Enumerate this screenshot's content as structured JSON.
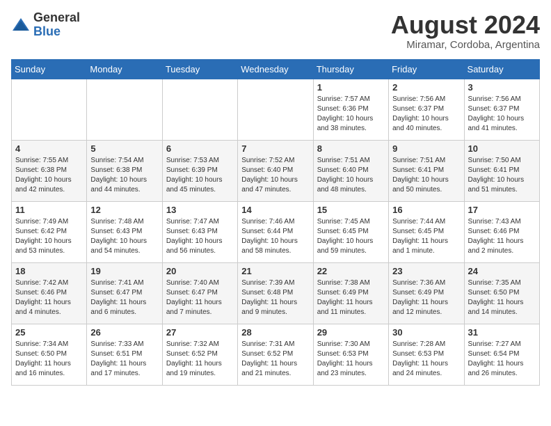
{
  "header": {
    "logo_line1": "General",
    "logo_line2": "Blue",
    "month_year": "August 2024",
    "location": "Miramar, Cordoba, Argentina"
  },
  "weekdays": [
    "Sunday",
    "Monday",
    "Tuesday",
    "Wednesday",
    "Thursday",
    "Friday",
    "Saturday"
  ],
  "rows": [
    [
      {
        "day": "",
        "info": ""
      },
      {
        "day": "",
        "info": ""
      },
      {
        "day": "",
        "info": ""
      },
      {
        "day": "",
        "info": ""
      },
      {
        "day": "1",
        "info": "Sunrise: 7:57 AM\nSunset: 6:36 PM\nDaylight: 10 hours\nand 38 minutes."
      },
      {
        "day": "2",
        "info": "Sunrise: 7:56 AM\nSunset: 6:37 PM\nDaylight: 10 hours\nand 40 minutes."
      },
      {
        "day": "3",
        "info": "Sunrise: 7:56 AM\nSunset: 6:37 PM\nDaylight: 10 hours\nand 41 minutes."
      }
    ],
    [
      {
        "day": "4",
        "info": "Sunrise: 7:55 AM\nSunset: 6:38 PM\nDaylight: 10 hours\nand 42 minutes."
      },
      {
        "day": "5",
        "info": "Sunrise: 7:54 AM\nSunset: 6:38 PM\nDaylight: 10 hours\nand 44 minutes."
      },
      {
        "day": "6",
        "info": "Sunrise: 7:53 AM\nSunset: 6:39 PM\nDaylight: 10 hours\nand 45 minutes."
      },
      {
        "day": "7",
        "info": "Sunrise: 7:52 AM\nSunset: 6:40 PM\nDaylight: 10 hours\nand 47 minutes."
      },
      {
        "day": "8",
        "info": "Sunrise: 7:51 AM\nSunset: 6:40 PM\nDaylight: 10 hours\nand 48 minutes."
      },
      {
        "day": "9",
        "info": "Sunrise: 7:51 AM\nSunset: 6:41 PM\nDaylight: 10 hours\nand 50 minutes."
      },
      {
        "day": "10",
        "info": "Sunrise: 7:50 AM\nSunset: 6:41 PM\nDaylight: 10 hours\nand 51 minutes."
      }
    ],
    [
      {
        "day": "11",
        "info": "Sunrise: 7:49 AM\nSunset: 6:42 PM\nDaylight: 10 hours\nand 53 minutes."
      },
      {
        "day": "12",
        "info": "Sunrise: 7:48 AM\nSunset: 6:43 PM\nDaylight: 10 hours\nand 54 minutes."
      },
      {
        "day": "13",
        "info": "Sunrise: 7:47 AM\nSunset: 6:43 PM\nDaylight: 10 hours\nand 56 minutes."
      },
      {
        "day": "14",
        "info": "Sunrise: 7:46 AM\nSunset: 6:44 PM\nDaylight: 10 hours\nand 58 minutes."
      },
      {
        "day": "15",
        "info": "Sunrise: 7:45 AM\nSunset: 6:45 PM\nDaylight: 10 hours\nand 59 minutes."
      },
      {
        "day": "16",
        "info": "Sunrise: 7:44 AM\nSunset: 6:45 PM\nDaylight: 11 hours\nand 1 minute."
      },
      {
        "day": "17",
        "info": "Sunrise: 7:43 AM\nSunset: 6:46 PM\nDaylight: 11 hours\nand 2 minutes."
      }
    ],
    [
      {
        "day": "18",
        "info": "Sunrise: 7:42 AM\nSunset: 6:46 PM\nDaylight: 11 hours\nand 4 minutes."
      },
      {
        "day": "19",
        "info": "Sunrise: 7:41 AM\nSunset: 6:47 PM\nDaylight: 11 hours\nand 6 minutes."
      },
      {
        "day": "20",
        "info": "Sunrise: 7:40 AM\nSunset: 6:47 PM\nDaylight: 11 hours\nand 7 minutes."
      },
      {
        "day": "21",
        "info": "Sunrise: 7:39 AM\nSunset: 6:48 PM\nDaylight: 11 hours\nand 9 minutes."
      },
      {
        "day": "22",
        "info": "Sunrise: 7:38 AM\nSunset: 6:49 PM\nDaylight: 11 hours\nand 11 minutes."
      },
      {
        "day": "23",
        "info": "Sunrise: 7:36 AM\nSunset: 6:49 PM\nDaylight: 11 hours\nand 12 minutes."
      },
      {
        "day": "24",
        "info": "Sunrise: 7:35 AM\nSunset: 6:50 PM\nDaylight: 11 hours\nand 14 minutes."
      }
    ],
    [
      {
        "day": "25",
        "info": "Sunrise: 7:34 AM\nSunset: 6:50 PM\nDaylight: 11 hours\nand 16 minutes."
      },
      {
        "day": "26",
        "info": "Sunrise: 7:33 AM\nSunset: 6:51 PM\nDaylight: 11 hours\nand 17 minutes."
      },
      {
        "day": "27",
        "info": "Sunrise: 7:32 AM\nSunset: 6:52 PM\nDaylight: 11 hours\nand 19 minutes."
      },
      {
        "day": "28",
        "info": "Sunrise: 7:31 AM\nSunset: 6:52 PM\nDaylight: 11 hours\nand 21 minutes."
      },
      {
        "day": "29",
        "info": "Sunrise: 7:30 AM\nSunset: 6:53 PM\nDaylight: 11 hours\nand 23 minutes."
      },
      {
        "day": "30",
        "info": "Sunrise: 7:28 AM\nSunset: 6:53 PM\nDaylight: 11 hours\nand 24 minutes."
      },
      {
        "day": "31",
        "info": "Sunrise: 7:27 AM\nSunset: 6:54 PM\nDaylight: 11 hours\nand 26 minutes."
      }
    ]
  ]
}
